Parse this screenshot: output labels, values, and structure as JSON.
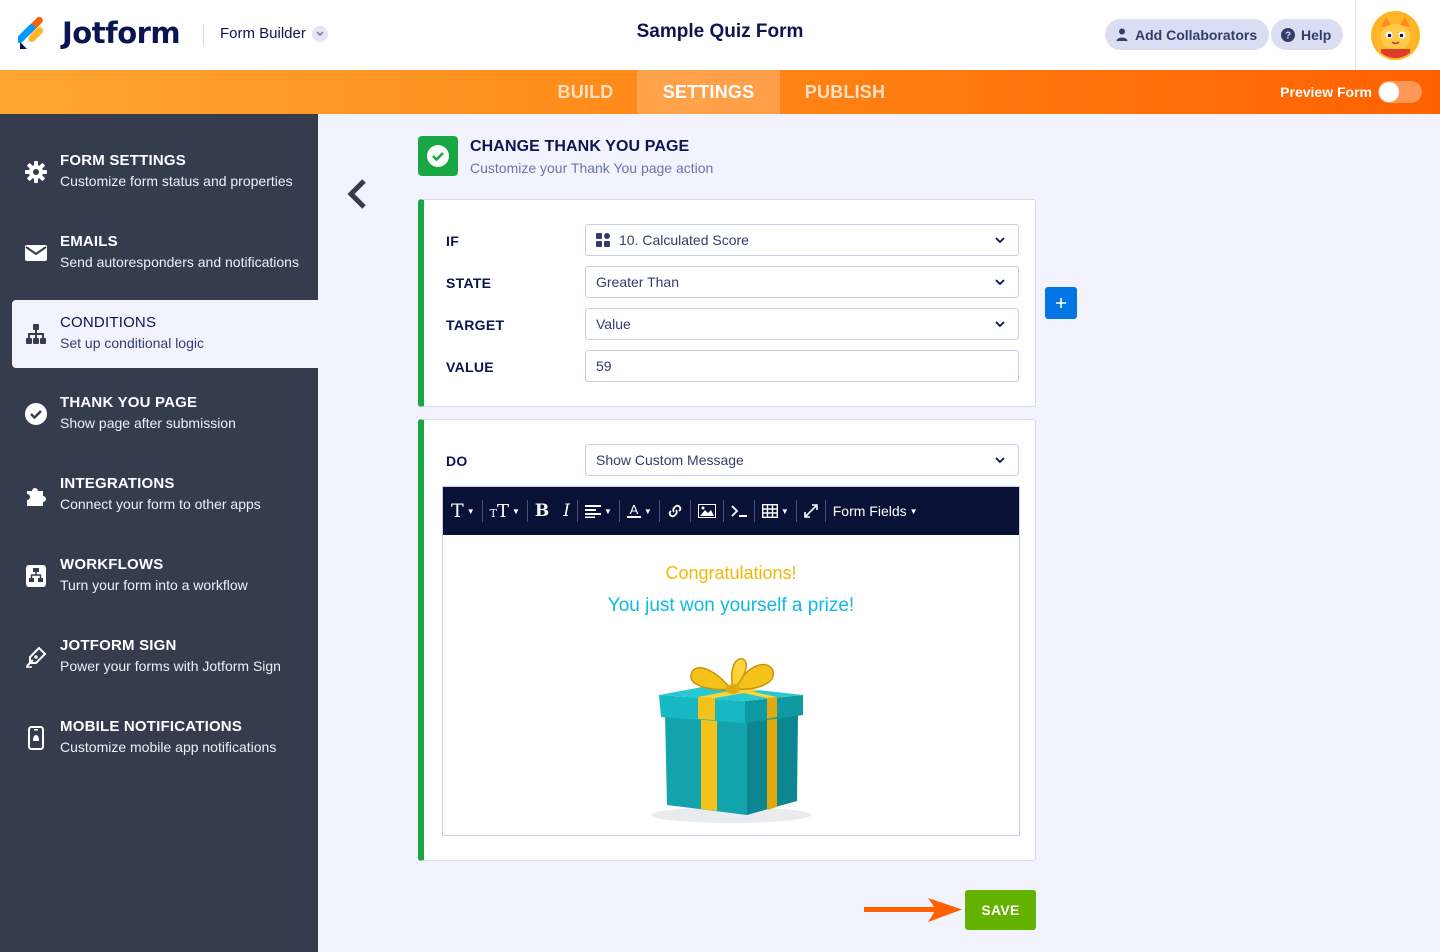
{
  "header": {
    "brand": "Jotform",
    "builder_label": "Form Builder",
    "form_title": "Sample Quiz Form",
    "add_collaborators": "Add Collaborators",
    "help": "Help"
  },
  "nav": {
    "tabs": [
      {
        "label": "BUILD",
        "active": false
      },
      {
        "label": "SETTINGS",
        "active": true
      },
      {
        "label": "PUBLISH",
        "active": false
      }
    ],
    "preview_label": "Preview Form",
    "preview_on": false
  },
  "sidebar": {
    "items": [
      {
        "title": "FORM SETTINGS",
        "subtitle": "Customize form status and properties",
        "icon": "gear-icon"
      },
      {
        "title": "EMAILS",
        "subtitle": "Send autoresponders and notifications",
        "icon": "envelope-icon"
      },
      {
        "title": "CONDITIONS",
        "subtitle": "Set up conditional logic",
        "icon": "sitemap-icon",
        "active": true
      },
      {
        "title": "THANK YOU PAGE",
        "subtitle": "Show page after submission",
        "icon": "check-circle-icon"
      },
      {
        "title": "INTEGRATIONS",
        "subtitle": "Connect your form to other apps",
        "icon": "puzzle-icon"
      },
      {
        "title": "WORKFLOWS",
        "subtitle": "Turn your form into a workflow",
        "icon": "workflow-icon"
      },
      {
        "title": "JOTFORM SIGN",
        "subtitle": "Power your forms with Jotform Sign",
        "icon": "pen-nib-icon"
      },
      {
        "title": "MOBILE NOTIFICATIONS",
        "subtitle": "Customize mobile app notifications",
        "icon": "mobile-bell-icon"
      }
    ]
  },
  "condition": {
    "title": "CHANGE THANK YOU PAGE",
    "subtitle": "Customize your Thank You page action",
    "if_label": "IF",
    "if_value": "10. Calculated Score",
    "state_label": "STATE",
    "state_value": "Greater Than",
    "target_label": "TARGET",
    "target_value": "Value",
    "value_label": "VALUE",
    "value_value": "59",
    "do_label": "DO",
    "do_value": "Show Custom Message"
  },
  "editor": {
    "form_fields_label": "Form Fields",
    "line1": "Congratulations!",
    "line2": "You just won yourself a prize!",
    "line1_color": "#f2b705",
    "line2_color": "#10b9e0"
  },
  "save_label": "SAVE",
  "colors": {
    "accent_orange": "#ff6100",
    "success_green": "#18a742",
    "save_green": "#64b200",
    "add_blue": "#0075e3",
    "sidebar_bg": "#343c4e"
  }
}
